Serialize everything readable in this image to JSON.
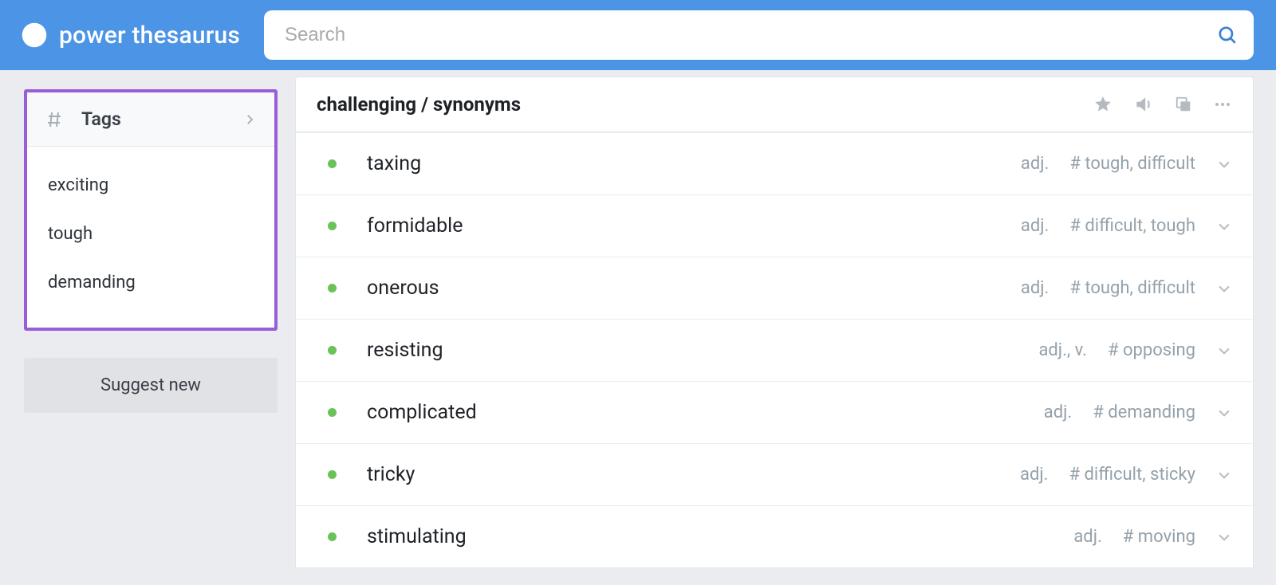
{
  "header": {
    "logo_text": "power thesaurus",
    "search_placeholder": "Search"
  },
  "sidebar": {
    "tags_title": "Tags",
    "tags": [
      "exciting",
      "tough",
      "demanding"
    ],
    "suggest_label": "Suggest new"
  },
  "main": {
    "title": "challenging / synonyms",
    "rows": [
      {
        "word": "taxing",
        "pos": "adj.",
        "tagrefs": "# tough, difficult"
      },
      {
        "word": "formidable",
        "pos": "adj.",
        "tagrefs": "# difficult, tough"
      },
      {
        "word": "onerous",
        "pos": "adj.",
        "tagrefs": "# tough, difficult"
      },
      {
        "word": "resisting",
        "pos": "adj., v.",
        "tagrefs": "# opposing"
      },
      {
        "word": "complicated",
        "pos": "adj.",
        "tagrefs": "# demanding"
      },
      {
        "word": "tricky",
        "pos": "adj.",
        "tagrefs": "# difficult, sticky"
      },
      {
        "word": "stimulating",
        "pos": "adj.",
        "tagrefs": "# moving"
      }
    ]
  }
}
